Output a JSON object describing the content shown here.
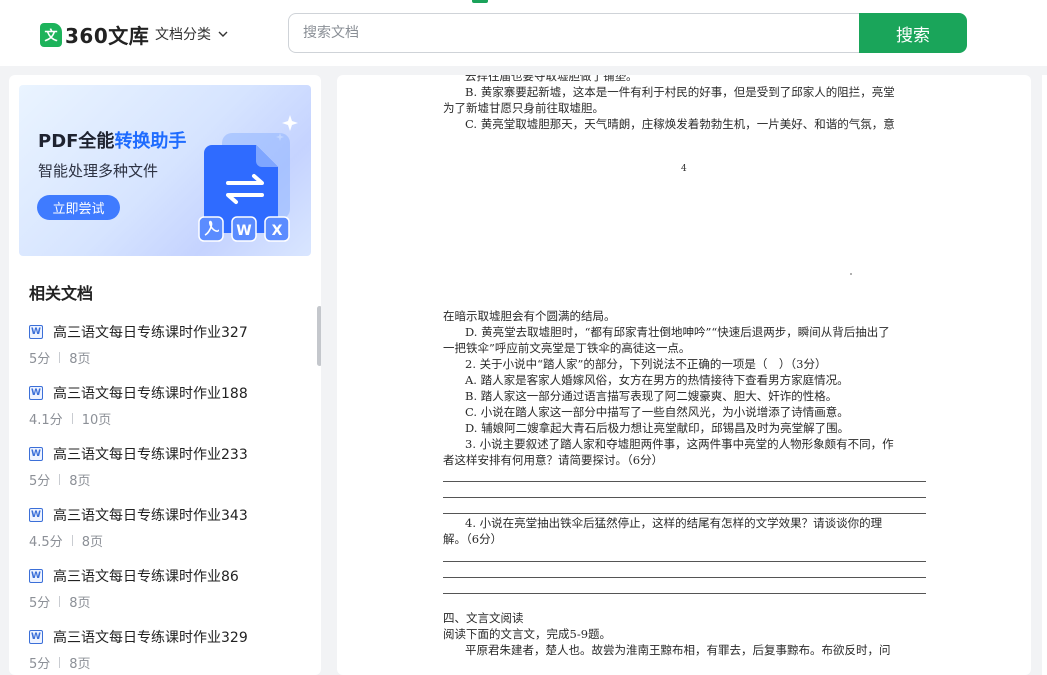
{
  "header": {
    "logo_mark": "文",
    "logo_text": "360文库",
    "category_label": "文档分类",
    "search_placeholder": "搜索文档",
    "search_button": "搜索"
  },
  "banner": {
    "title_prefix": "PDF全能",
    "title_highlight": "转换助手",
    "subtitle": "智能处理多种文件",
    "cta": "立即尝试",
    "badges": [
      "W",
      "X"
    ]
  },
  "related": {
    "title": "相关文档",
    "items": [
      {
        "name": "高三语文每日专练课时作业327",
        "score": "5分",
        "pages": "8页"
      },
      {
        "name": "高三语文每日专练课时作业188",
        "score": "4.1分",
        "pages": "10页"
      },
      {
        "name": "高三语文每日专练课时作业233",
        "score": "5分",
        "pages": "8页"
      },
      {
        "name": "高三语文每日专练课时作业343",
        "score": "4.5分",
        "pages": "8页"
      },
      {
        "name": "高三语文每日专练课时作业86",
        "score": "5分",
        "pages": "8页"
      },
      {
        "name": "高三语文每日专练课时作业329",
        "score": "5分",
        "pages": "8页"
      }
    ]
  },
  "document": {
    "page_number": "4",
    "lines_top": [
      "去捍往届也要夺取墟胆做了铺垫。",
      "B. 黄家寨要起新墟，这本是一件有利于村民的好事，但是受到了邱家人的阻拦，亮堂",
      "为了新墟甘愿只身前往取墟胆。",
      "C. 黄亮堂取墟胆那天，天气晴朗，庄稼焕发着勃勃生机，一片美好、和谐的气氛，意"
    ],
    "lines_mid": [
      "在暗示取墟胆会有个圆满的结局。",
      "D. 黄亮堂去取墟胆时，“都有邱家青壮倒地呻吟”“快速后退两步，瞬间从背后抽出了",
      "一把铁伞”呼应前文亮堂是丁铁伞的高徒这一点。",
      "2. 关于小说中“踏人家”的部分，下列说法不正确的一项是（　）（3分）",
      "A. 踏人家是客家人婚嫁风俗，女方在男方的热情接待下查看男方家庭情况。",
      "B. 踏人家这一部分通过语言描写表现了阿二嫂豪爽、胆大、奸诈的性格。",
      "C. 小说在踏人家这一部分中描写了一些自然风光，为小说增添了诗情画意。",
      "D. 辅娘阿二嫂拿起大青石后极力想让亮堂献印，邱锡昌及时为亮堂解了围。",
      "3. 小说主要叙述了踏人家和夺墟胆两件事，这两件事中亮堂的人物形象颇有不同，作",
      "者这样安排有何用意？请简要探讨。（6分）"
    ],
    "q4_lines": [
      "4. 小说在亮堂抽出铁伞后猛然停止，这样的结尾有怎样的文学效果？请谈谈你的理",
      "解。（6分）"
    ],
    "section_lines": [
      "四、文言文阅读",
      "阅读下面的文言文，完成5-9题。",
      "平原君朱建者，楚人也。故尝为淮南王黥布相，有罪去，后复事黥布。布欲反时，问"
    ]
  }
}
